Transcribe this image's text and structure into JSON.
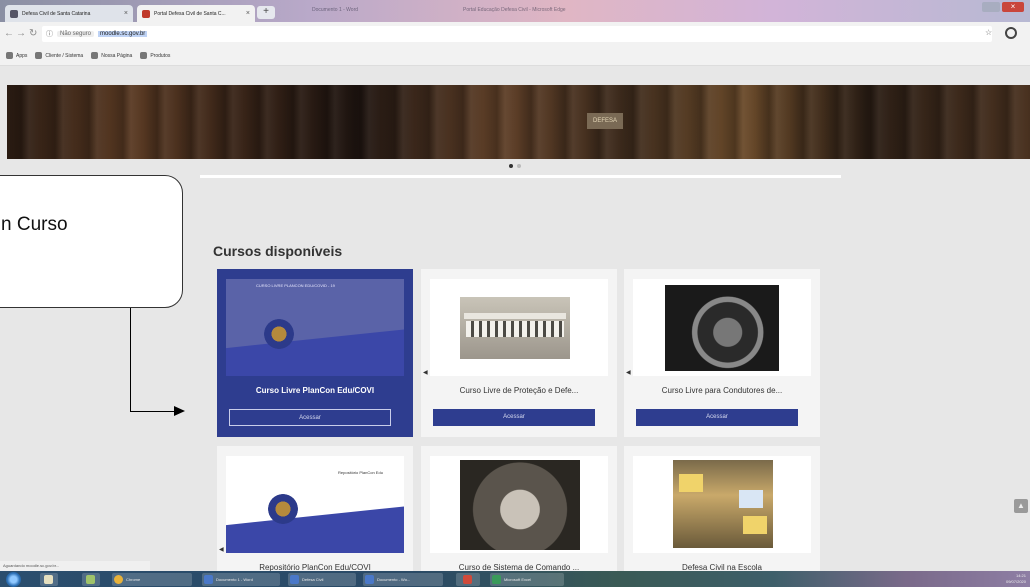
{
  "browser": {
    "tabs": [
      {
        "label": "Defesa Civil de Santa Catarina",
        "active": false
      },
      {
        "label": "Portal Defesa Civil de Santa C...",
        "active": true
      }
    ],
    "faded_tabs": [
      "Documento 1 - Word",
      "Portal Educação Defesa Civil - Microsoft Edge"
    ],
    "address": {
      "security": "Não seguro",
      "url": "moodle.sc.gov.br"
    },
    "bookmarks": [
      "Apps",
      "Cliente / Sistema",
      "Nossa Página",
      "Produtos"
    ]
  },
  "page": {
    "banner_sign": "DEFESA",
    "section_title": "Cursos disponíveis",
    "courses": [
      {
        "title": "Curso Livre PlanCon Edu/COVI",
        "button": "Acessar",
        "selected": true,
        "thumb_caption": "CURSO LIVRE PLANCON EDU/COVID - 19"
      },
      {
        "title": "Curso Livre de Proteção e Defe...",
        "button": "Acessar",
        "selected": false
      },
      {
        "title": "Curso Livre para Condutores de...",
        "button": "Acessar",
        "selected": false
      },
      {
        "title": "Repositório PlanCon Edu/COVI",
        "button": "",
        "selected": false,
        "thumb_caption": "Repositório PlanCon Edu"
      },
      {
        "title": "Curso de Sistema de Comando ...",
        "button": "",
        "selected": false
      },
      {
        "title": "Defesa Civil na Escola",
        "button": "",
        "selected": false
      }
    ]
  },
  "callout": {
    "text": "n Curso"
  },
  "status_bar": {
    "text": "Aguardando moodle.sc.gov.br..."
  },
  "taskbar": {
    "items": [
      "Chrome",
      "Documento 1 - Word",
      "Defesa Civil",
      "Documento - Wo...",
      "Excel",
      "Microsoft Excel"
    ],
    "clock_time": "14:21",
    "clock_date": "09/07/2020"
  }
}
